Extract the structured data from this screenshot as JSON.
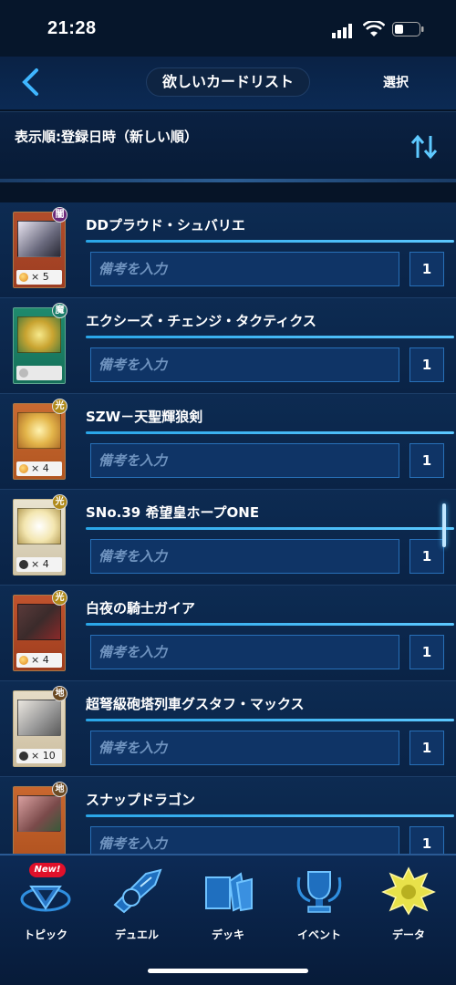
{
  "status": {
    "time": "21:28"
  },
  "header": {
    "title": "欲しいカードリスト",
    "select_label": "選択"
  },
  "sort": {
    "label": "表示順:登録日時（新しい順）"
  },
  "items": [
    {
      "name": "DDプラウド・シュバリエ",
      "attr": "闇",
      "stat": "× 5",
      "note_placeholder": "備考を入力",
      "qty": "1"
    },
    {
      "name": "エクシーズ・チェンジ・タクティクス",
      "attr": "魔",
      "stat": "",
      "note_placeholder": "備考を入力",
      "qty": "1"
    },
    {
      "name": "SZW－天聖輝狼剣",
      "attr": "光",
      "stat": "× 4",
      "note_placeholder": "備考を入力",
      "qty": "1"
    },
    {
      "name": "SNo.39 希望皇ホープONE",
      "attr": "光",
      "stat": "× 4",
      "note_placeholder": "備考を入力",
      "qty": "1"
    },
    {
      "name": "白夜の騎士ガイア",
      "attr": "光",
      "stat": "× 4",
      "note_placeholder": "備考を入力",
      "qty": "1"
    },
    {
      "name": "超弩級砲塔列車グスタフ・マックス",
      "attr": "地",
      "stat": "× 10",
      "note_placeholder": "備考を入力",
      "qty": "1"
    },
    {
      "name": "スナップドラゴン",
      "attr": "地",
      "stat": "",
      "note_placeholder": "備考を入力",
      "qty": "1"
    }
  ],
  "nav": {
    "new_badge": "New!",
    "items": [
      "トピック",
      "デュエル",
      "デッキ",
      "イベント",
      "データ"
    ]
  }
}
